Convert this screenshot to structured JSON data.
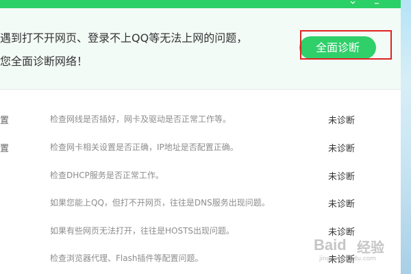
{
  "header": {
    "message_line1": "遇到打不开网页、登录不上QQ等无法上网的问题，",
    "message_line2": "您全面诊断网络！",
    "diagnose_button": "全面诊断"
  },
  "rows": [
    {
      "name": "置",
      "description": "检查网线是否插好，网卡及驱动是否正常工作等。",
      "status": "未诊断"
    },
    {
      "name": "置",
      "description": "检查网卡相关设置是否正确，IP地址是否配置正确。",
      "status": "未诊断"
    },
    {
      "name": "",
      "description": "检查DHCP服务是否正常工作。",
      "status": "未诊断"
    },
    {
      "name": "",
      "description": "如果您能上QQ，但打不开网页，往往是DNS服务出现问题。",
      "status": "未诊断"
    },
    {
      "name": "",
      "description": "如果有些网页无法打开，往往是HOSTS出现问题。",
      "status": "未诊断"
    },
    {
      "name": "",
      "description": "检查浏览器代理、Flash插件等配置问题。",
      "status": "未诊断"
    }
  ],
  "watermark": {
    "brand": "Baid",
    "brand_suffix": "经验",
    "url": "jingyan.baidu.com"
  },
  "colors": {
    "accent_green": "#2fcf69",
    "highlight_red": "#e02020"
  }
}
